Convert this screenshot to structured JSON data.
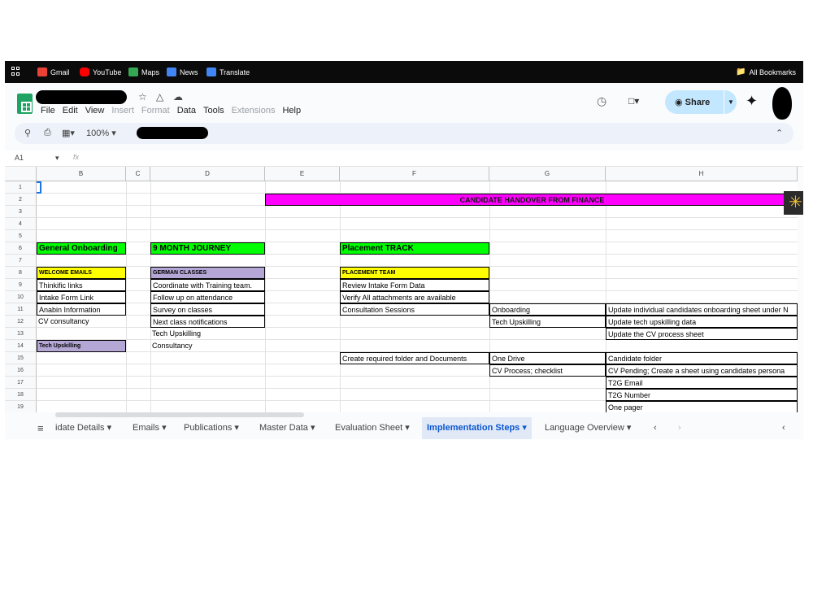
{
  "bookmarks": [
    {
      "label": "Gmail",
      "icon": "gmail-icon",
      "color": "#ea4335"
    },
    {
      "label": "YouTube",
      "icon": "youtube-icon",
      "color": "#ff0000"
    },
    {
      "label": "Maps",
      "icon": "maps-icon",
      "color": "#34a853"
    },
    {
      "label": "News",
      "icon": "news-icon",
      "color": "#4285f4"
    },
    {
      "label": "Translate",
      "icon": "translate-icon",
      "color": "#4285f4"
    }
  ],
  "all_bookmarks": "All Bookmarks",
  "menu": [
    "File",
    "Edit",
    "View",
    "Insert",
    "Format",
    "Data",
    "Tools",
    "Extensions",
    "Help"
  ],
  "share_label": "Share",
  "toolbar": {
    "zoom": "100%"
  },
  "formula": {
    "cell_ref": "A1",
    "fx": "fx"
  },
  "columns": [
    "B",
    "C",
    "D",
    "E",
    "F",
    "G",
    "H"
  ],
  "rows": [
    "1",
    "2",
    "3",
    "4",
    "5",
    "6",
    "7",
    "8",
    "9",
    "10",
    "11",
    "12",
    "13",
    "14",
    "15",
    "16",
    "17",
    "18",
    "19"
  ],
  "cells": {
    "banner": "CANDIDATE HANDOVER FROM FINANCE",
    "general_onboarding": "General Onboarding",
    "month_journey": "9 MONTH JOURNEY",
    "placement_track": "Placement TRACK",
    "welcome_emails": "WELCOME EMAILS",
    "german_classes": "GERMAN CLASSES",
    "placement_team": "PLACEMENT TEAM",
    "b9": "Thinkific links",
    "b10": "Intake Form Link",
    "b11": "Anabin Information",
    "b12": "CV consultancy",
    "b14": "Tech Upskilling",
    "d9": "Coordinate with Training team.",
    "d10": "Follow up on attendance",
    "d11": "Survey on classes",
    "d12": "Next class notifications",
    "d13": "Tech Upskilling",
    "d14": "Consultancy",
    "f9": "Review Intake Form Data",
    "f10": "Verify All attachments are available",
    "f11": "Consultation Sessions",
    "f15": "Create required folder and Documents",
    "g11": "Onboarding",
    "g12": "Tech Upskilling",
    "g15": "One Drive",
    "g16": "CV Process; checklist",
    "h11": "Update individual candidates onboarding sheet under N",
    "h12": "Update tech upskilling data",
    "h13": "Update the CV process sheet",
    "h15": "Candidate folder",
    "h16": "CV Pending; Create a sheet using candidates persona",
    "h17": "T2G Email",
    "h18": "T2G Number",
    "h19": "One pager"
  },
  "sheet_tabs": [
    "idate Details",
    "Emails",
    "Publications",
    "Master Data",
    "Evaluation Sheet",
    "Implementation Steps",
    "Language Overview"
  ],
  "active_tab": "Implementation Steps"
}
